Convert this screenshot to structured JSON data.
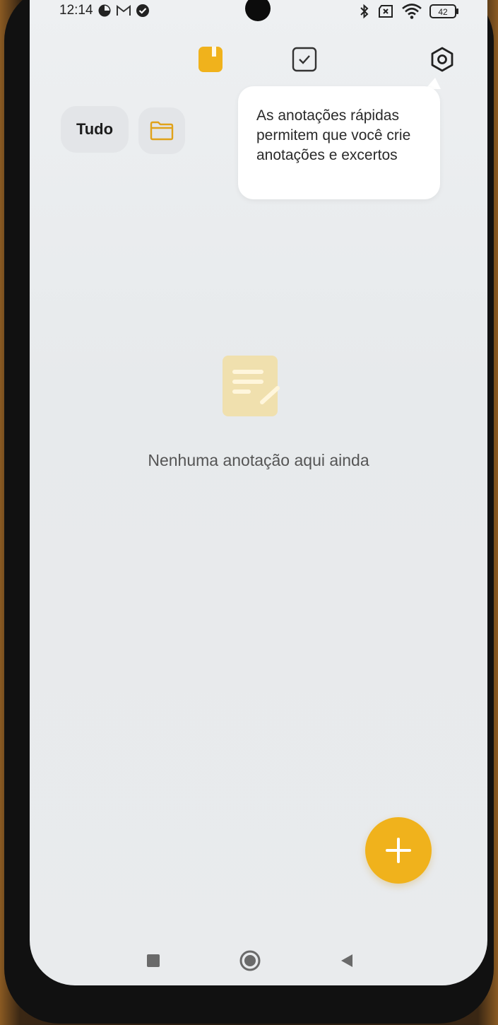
{
  "status_bar": {
    "time": "12:14",
    "left_icons": [
      "data-saver-icon",
      "gmail-icon",
      "check-circle-icon"
    ],
    "right_icons": [
      "bluetooth-icon",
      "sim-off-icon",
      "wifi-icon"
    ],
    "battery": "42"
  },
  "toolbar": {
    "icons": [
      "notes-tab-icon",
      "tasks-tab-icon",
      "settings-icon"
    ],
    "active": "notes-tab-icon"
  },
  "filters": {
    "all_label": "Tudo",
    "folder_icon": "folder-icon"
  },
  "tooltip": {
    "text": "As anotações rápidas permitem que você crie anotações e excertos"
  },
  "empty_state": {
    "icon": "empty-note-icon",
    "message": "Nenhuma anotação aqui ainda"
  },
  "fab": {
    "icon": "plus-icon"
  },
  "nav_bar": {
    "items": [
      "recents-button",
      "home-button",
      "back-button"
    ]
  },
  "colors": {
    "accent": "#f0b21c",
    "background": "#eceef0",
    "text": "#555555"
  }
}
